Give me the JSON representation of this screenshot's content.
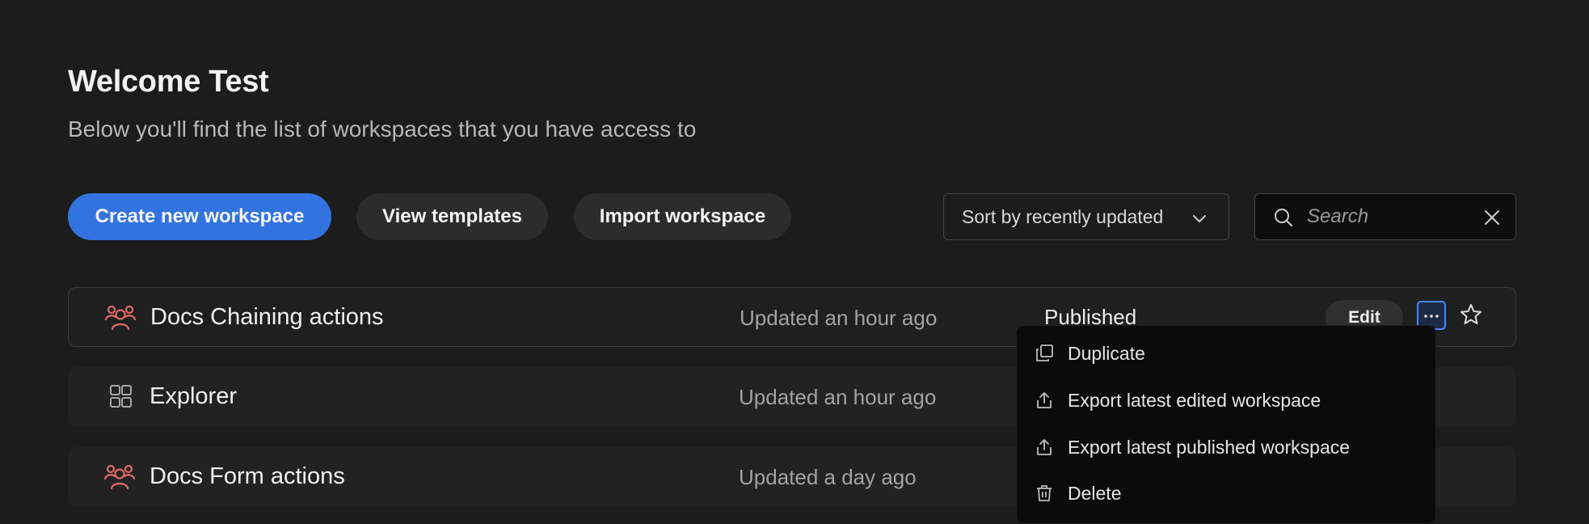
{
  "header": {
    "title": "Welcome Test",
    "subtitle": "Below you'll find the list of workspaces that you have access to"
  },
  "actions": {
    "create_label": "Create new workspace",
    "templates_label": "View templates",
    "import_label": "Import workspace"
  },
  "sort": {
    "value": "Sort by recently updated",
    "icon": "chevron-down-icon"
  },
  "search": {
    "placeholder": "Search",
    "value": "",
    "icon": "search-icon",
    "clear_icon": "close-icon"
  },
  "workspaces": [
    {
      "name": "Docs Chaining actions",
      "updated": "Updated an hour ago",
      "status": "Published",
      "icon": "users-icon",
      "edit_label": "Edit"
    },
    {
      "name": "Explorer",
      "updated": "Updated an hour ago",
      "status": "",
      "icon": "grid-icon"
    },
    {
      "name": "Docs Form actions",
      "updated": "Updated a day ago",
      "status": "",
      "icon": "users-icon"
    }
  ],
  "context_menu": {
    "items": [
      {
        "label": "Duplicate",
        "icon": "duplicate-icon"
      },
      {
        "label": "Export latest edited workspace",
        "icon": "export-icon"
      },
      {
        "label": "Export latest published workspace",
        "icon": "export-icon"
      },
      {
        "label": "Delete",
        "icon": "trash-icon"
      }
    ]
  },
  "colors": {
    "background": "#1c1c1c",
    "primary": "#3273e0",
    "users_icon": "#e06a63",
    "focus_ring": "#3d8bff"
  }
}
